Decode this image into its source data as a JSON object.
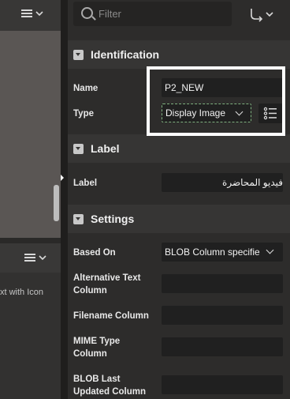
{
  "left_panel": {
    "top_menu_icon": "hamburger-menu-icon",
    "bottom_menu_icon": "hamburger-menu-icon",
    "item_text": "xt with Icon"
  },
  "search": {
    "placeholder": "Filter",
    "icon": "search-icon"
  },
  "goto_icon": "goto-arrow-icon",
  "sections": {
    "identification": {
      "title": "Identification",
      "name_label": "Name",
      "name_value": "P2_NEW",
      "type_label": "Type",
      "type_value": "Display Image"
    },
    "label": {
      "title": "Label",
      "label_label": "Label",
      "label_value": "فيديو المحاضرة"
    },
    "settings": {
      "title": "Settings",
      "based_on_label": "Based On",
      "based_on_value": "BLOB Column specifie",
      "alt_text_label_line1": "Alternative Text",
      "alt_text_label_line2": "Column",
      "filename_label": "Filename Column",
      "mime_label_line1": "MIME Type",
      "mime_label_line2": "Column",
      "blob_updated_label_line1": "BLOB Last",
      "blob_updated_label_line2": "Updated Column"
    }
  },
  "colors": {
    "highlight": "#ffffff",
    "accent_focus": "#7fb07f"
  }
}
